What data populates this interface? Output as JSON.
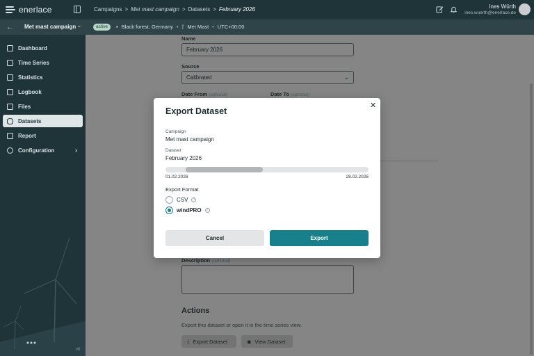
{
  "app": {
    "logo_text": "enerlace"
  },
  "breadcrumb": [
    "Campaigns",
    ">",
    "Met mast campaign",
    ">",
    "Datasets",
    ">",
    "February 2026"
  ],
  "user": {
    "name": "Ines Würth",
    "email": "ines.wuerth@enerlace.de"
  },
  "subbar": {
    "campaign_name": "Met mast campaign",
    "status_badge": "active",
    "location": "Black forest, Germany",
    "station": "Met Mast",
    "timezone": "UTC+00:00"
  },
  "sidebar": {
    "items": [
      {
        "label": "Dashboard",
        "icon": "grid-icon"
      },
      {
        "label": "Time Series",
        "icon": "line-chart-icon"
      },
      {
        "label": "Statistics",
        "icon": "stats-icon"
      },
      {
        "label": "Logbook",
        "icon": "pencil-icon"
      },
      {
        "label": "Files",
        "icon": "file-icon"
      },
      {
        "label": "Datasets",
        "icon": "database-icon",
        "active": true
      },
      {
        "label": "Report",
        "icon": "report-icon"
      },
      {
        "label": "Configuration",
        "icon": "gear-icon"
      }
    ],
    "version": "v0"
  },
  "form": {
    "name_label": "Name",
    "name_value": "February 2026",
    "source_label": "Source",
    "source_value": "Calibrated",
    "date_from_label": "Date From",
    "date_to_label": "Date To",
    "optional": "(optional)",
    "description_label": "Description",
    "actions_title": "Actions",
    "actions_desc": "Export this dataset or open it in the time series view.",
    "export_button": "Export Dataset",
    "view_button": "View Dataset"
  },
  "modal": {
    "title": "Export Dataset",
    "campaign_label": "Campaign",
    "campaign_value": "Met mast campaign",
    "dataset_label": "Dataset",
    "dataset_value": "February 2026",
    "range_start": "01.02.2026",
    "range_end": "28.02.2026",
    "range_selected_fraction": [
      0.1,
      0.48
    ],
    "format_title": "Export Format",
    "formats": [
      {
        "label": "CSV",
        "checked": false
      },
      {
        "label": "windPRO",
        "checked": true
      }
    ],
    "cancel": "Cancel",
    "export": "Export"
  },
  "colors": {
    "accent": "#17808a",
    "sidebar": "#1f3439",
    "active_nav": "#dfe6e8"
  }
}
